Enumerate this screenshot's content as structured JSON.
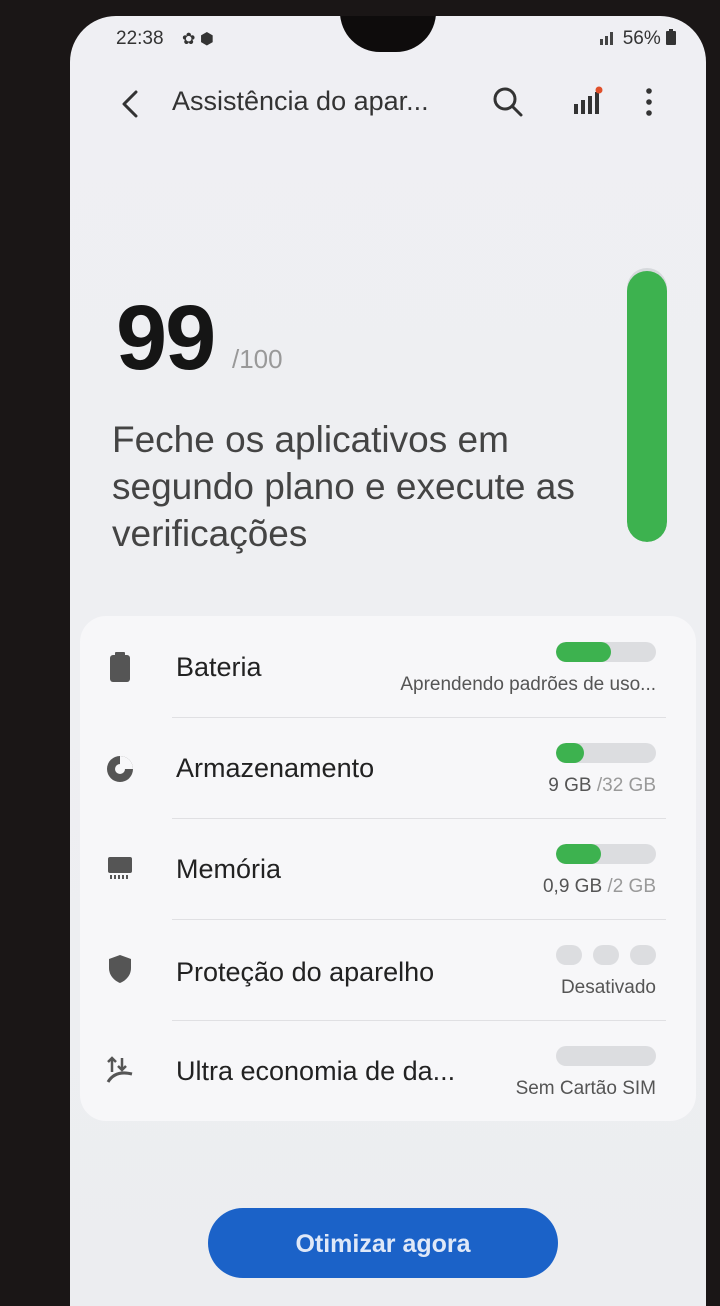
{
  "status_bar": {
    "time": "22:38",
    "icons": "✿ ⬢",
    "battery": "56%"
  },
  "app_bar": {
    "title": "Assistência do apar..."
  },
  "score": {
    "value": "99",
    "max": "/100",
    "level": 0.99,
    "message": "Feche os aplicativos em segundo plano e execute as verificações"
  },
  "items": [
    {
      "label": "Bateria",
      "status": "Aprendendo padrões de uso...",
      "level": 0.55,
      "icon": "battery-icon"
    },
    {
      "label": "Armazenamento",
      "used": "9 GB",
      "total": " /32 GB",
      "level": 0.28,
      "icon": "storage-pie-icon"
    },
    {
      "label": "Memória",
      "used": "0,9 GB",
      "total": " /2 GB",
      "level": 0.45,
      "icon": "memory-chip-icon"
    },
    {
      "label": "Proteção do aparelho",
      "status": "Desativado",
      "icon": "shield-icon"
    },
    {
      "label": "Ultra economia de da...",
      "status": "Sem Cartão SIM",
      "level": 0,
      "icon": "data-saver-icon"
    }
  ],
  "colors": {
    "accent_green": "#3db24f",
    "button_blue": "#1b62c8"
  },
  "actions": {
    "optimize": "Otimizar agora"
  }
}
